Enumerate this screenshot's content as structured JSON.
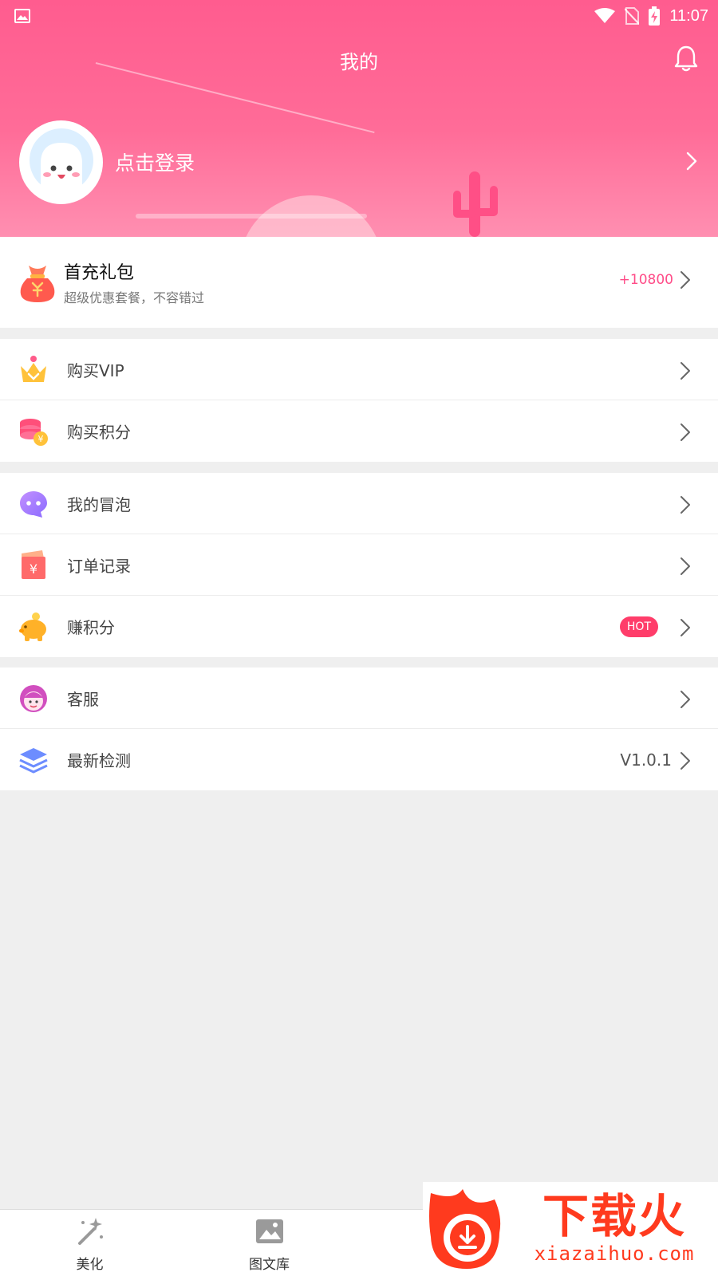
{
  "status_bar": {
    "time": "11:07"
  },
  "header": {
    "title": "我的"
  },
  "profile": {
    "login_label": "点击登录"
  },
  "gift": {
    "title": "首充礼包",
    "subtitle": "超级优惠套餐，不容错过",
    "amount": "+10800"
  },
  "menu_groups": [
    [
      {
        "label": "购买VIP",
        "icon": "crown-icon"
      },
      {
        "label": "购买积分",
        "icon": "coins-icon"
      }
    ],
    [
      {
        "label": "我的冒泡",
        "icon": "chat-bubble-icon"
      },
      {
        "label": "订单记录",
        "icon": "wallet-icon"
      },
      {
        "label": "赚积分",
        "icon": "piggy-bank-icon",
        "badge": "HOT"
      }
    ],
    [
      {
        "label": "客服",
        "icon": "customer-service-icon"
      },
      {
        "label": "最新检测",
        "icon": "layers-icon",
        "value": "V1.0.1"
      }
    ]
  ],
  "tabbar": {
    "tabs": [
      {
        "label": "美化",
        "icon": "magic-wand-icon"
      },
      {
        "label": "图文库",
        "icon": "image-icon"
      },
      {
        "label": "",
        "icon": ""
      },
      {
        "label": "",
        "icon": ""
      }
    ]
  },
  "watermark": {
    "title": "下载火",
    "url": "xiazaihuo.com"
  },
  "colors": {
    "accent": "#ff5c8f",
    "gift_amount": "#ff4c88",
    "hot_badge": "#ff3d6a",
    "watermark": "#ff3a1e"
  }
}
